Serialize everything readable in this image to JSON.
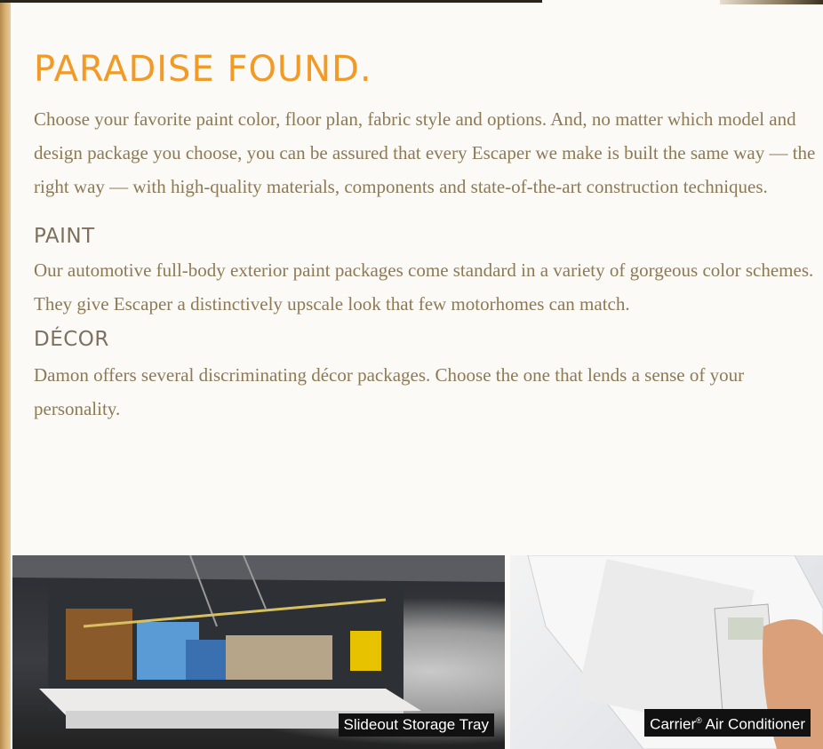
{
  "heading": "PARADISE FOUND.",
  "intro": "Choose your favorite paint color, floor plan, fabric style and options. And, no matter which model and design package you choose, you can be assured that every Escaper we make is built the same way — the right way — with high-quality materials, components and state-of-the-art construction techniques.",
  "paint": {
    "title": "PAINT",
    "body": "Our automotive full-body exterior paint packages come standard in a variety of gorgeous color schemes. They give Escaper a distinctively upscale look that few motorhomes can match."
  },
  "decor": {
    "title": "DÉCOR",
    "body": "Damon offers several discriminating décor packages. Choose the one that lends a sense of your personality."
  },
  "photos": {
    "storage_caption": "Slideout Storage Tray",
    "ac_caption_brand": "Carrier",
    "ac_caption_reg": "®",
    "ac_caption_rest": " Air Conditioner"
  },
  "colors": {
    "heading": "#f29a26",
    "body_text": "#8d7a55",
    "subheading": "#7d705f"
  }
}
